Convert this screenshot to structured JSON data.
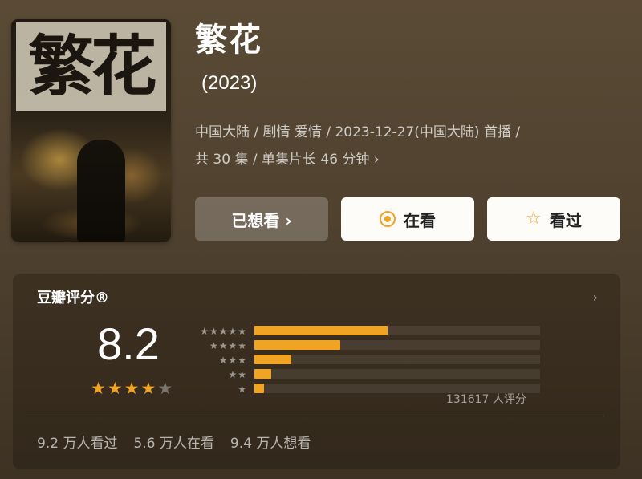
{
  "show": {
    "title": "繁花",
    "year": "(2023)",
    "meta_line1": "中国大陆 / 剧情 爱情 / 2023-12-27(中国大陆) 首播 /",
    "meta_line2": "共 30 集 / 单集片长 46 分钟 ›",
    "poster_title": "繁花"
  },
  "actions": {
    "wish_label": "已想看 ›",
    "doing_label": "在看",
    "done_label": "看过"
  },
  "rating": {
    "header": "豆瓣评分®",
    "arrow": "›",
    "score": "8.2",
    "stars_on": "★★★★",
    "stars_off": "★",
    "star_rows": [
      "★★★★★",
      "★★★★",
      "★★★",
      "★★",
      "★"
    ],
    "distribution": [
      0.465,
      0.3,
      0.13,
      0.06,
      0.035
    ],
    "count_text": "131617 人评分",
    "stats": [
      "9.2 万人看过",
      "5.6 万人在看",
      "9.4 万人想看"
    ]
  },
  "colors": {
    "accent": "#f1a324",
    "background": "#4d3f2d"
  }
}
